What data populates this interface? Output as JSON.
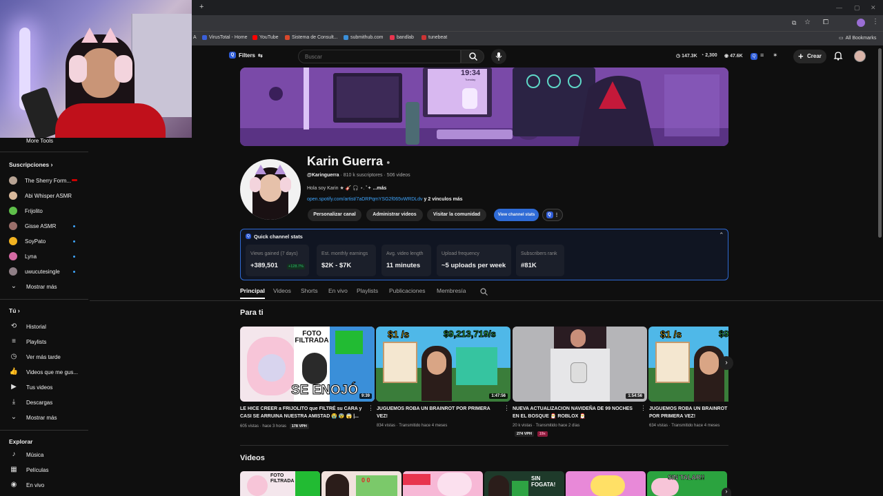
{
  "browser": {
    "new_tab": "+",
    "bookmarks": [
      {
        "label": "A",
        "color": "#888888"
      },
      {
        "label": "VirusTotal - Home",
        "color": "#3a5fd9"
      },
      {
        "label": "YouTube",
        "color": "#ff0000"
      },
      {
        "label": "Sistema de Consult...",
        "color": "#d9482b"
      },
      {
        "label": "submithub.com",
        "color": "#3a8fd9"
      },
      {
        "label": "bandlab",
        "color": "#e8344e"
      },
      {
        "label": "tunebeat",
        "color": "#cc3333"
      }
    ],
    "all_bookmarks": "All Bookmarks"
  },
  "topbar": {
    "filters": "Filters",
    "search_placeholder": "Buscar",
    "stats": [
      "147.3K",
      "2,300",
      "47.6K"
    ],
    "create": "Crear"
  },
  "sidebar": {
    "more_tools": "More Tools",
    "subs_title": "Suscripciones",
    "subscriptions": [
      {
        "name": "The Sherry Form...",
        "color": "#b7a393",
        "live": "red"
      },
      {
        "name": "Abi Whisper ASMR",
        "color": "#d8b89a",
        "live": ""
      },
      {
        "name": "Frijolito",
        "color": "#5fbf4a",
        "live": ""
      },
      {
        "name": "Gisse ASMR",
        "color": "#9b6f6a",
        "live": "blue"
      },
      {
        "name": "SoyPato",
        "color": "#f2b321",
        "live": "blue"
      },
      {
        "name": "Lyna",
        "color": "#d56aa4",
        "live": "blue"
      },
      {
        "name": "uwucutesingle",
        "color": "#8f7f86",
        "live": "blue"
      }
    ],
    "show_more": "Mostrar más",
    "you_title": "Tú",
    "you_items": [
      {
        "label": "Historial",
        "icon": "history-icon",
        "glyph": "⟲"
      },
      {
        "label": "Playlists",
        "icon": "playlists-icon",
        "glyph": "≡"
      },
      {
        "label": "Ver más tarde",
        "icon": "watch-later-icon",
        "glyph": "◷"
      },
      {
        "label": "Videos que me gus...",
        "icon": "like-icon",
        "glyph": "👍"
      },
      {
        "label": "Tus videos",
        "icon": "your-videos-icon",
        "glyph": "▶"
      },
      {
        "label": "Descargas",
        "icon": "downloads-icon",
        "glyph": "⤓"
      },
      {
        "label": "Mostrar más",
        "icon": "chevron-down-icon",
        "glyph": "⌄"
      }
    ],
    "explore_title": "Explorar",
    "explore_items": [
      {
        "label": "Música",
        "icon": "music-icon",
        "glyph": "♪"
      },
      {
        "label": "Películas",
        "icon": "movies-icon",
        "glyph": "▦"
      },
      {
        "label": "En vivo",
        "icon": "live-icon",
        "glyph": "◉"
      }
    ]
  },
  "banner": {
    "clock": "19:34",
    "label": "Tuesday"
  },
  "channel": {
    "name": "Karin Guerra",
    "handle": "@Karinguerra",
    "subscribers": "810 k suscriptores",
    "videos": "506 videos",
    "description": "Hola soy Karin ★ 🎸 🎧 ⋆. ˚✦",
    "more": "...más",
    "link": "open.spotify.com/artist/7aDRPqmYSG2f065vWRDLdv",
    "link_more": "y 2 vínculos más",
    "buttons": [
      "Personalizar canal",
      "Administrar videos",
      "Visitar la comunidad"
    ],
    "view_stats": "View channel stats"
  },
  "quick_stats": {
    "title": "Quick channel stats",
    "cards": [
      {
        "label": "Views gained (7 days)",
        "value": "+389,501",
        "delta": "+128.7%"
      },
      {
        "label": "Est. monthly earnings",
        "value": "$2K - $7K",
        "delta": ""
      },
      {
        "label": "Avg. video length",
        "value": "11 minutes",
        "delta": ""
      },
      {
        "label": "Upload frequency",
        "value": "~5 uploads per week",
        "delta": ""
      },
      {
        "label": "Subscribers rank",
        "value": "#81K",
        "delta": ""
      }
    ]
  },
  "tabs": [
    "Principal",
    "Videos",
    "Shorts",
    "En vivo",
    "Playlists",
    "Publicaciones",
    "Membresía"
  ],
  "sections": {
    "for_you": "Para ti",
    "videos": "Videos"
  },
  "videos": [
    {
      "title": "LE HICE CREER a FRIJOLITO que FILTRÉ su CARA y CASI SE ARRUINA NUESTRA AMISTAD 😭 😰 😱 |...",
      "duration": "9:39",
      "views": "605 vistas",
      "when": "hace 3 horas",
      "vph": "178 VPH",
      "extra": "",
      "thumb_text": "SE ENOJÓ",
      "thumb_top": "FOTO FILTRADA"
    },
    {
      "title": "JUGUEMOS ROBA UN BRAINROT POR PRIMERA VEZ!",
      "duration": "1:47:56",
      "views": "834 vistas",
      "when": "Transmitido hace 4 meses",
      "vph": "",
      "extra": "",
      "thumb_text": "$9,213,719/s",
      "thumb_top": "$1 /s"
    },
    {
      "title": "NUEVA ACTUALIZACION NAVIDEÑA DE 99 NOCHES EN EL BOSQUE 🎅 ROBLOX 🎅",
      "duration": "1:54:56",
      "views": "20 k vistas",
      "when": "Transmitido hace 2 días",
      "vph": "274 VPH",
      "extra": "19x",
      "thumb_text": "",
      "thumb_top": ""
    },
    {
      "title": "JUGUEMOS ROBA UN BRAINROT POR PRIMERA VEZ!",
      "duration": "",
      "views": "634 vistas",
      "when": "Transmitido hace 4 meses",
      "vph": "",
      "extra": "",
      "thumb_text": "$9",
      "thumb_top": "$1 /s"
    }
  ],
  "videos_row2": [
    {
      "text": "FOTO FILTRADA"
    },
    {
      "text": "0 0"
    },
    {
      "text": ""
    },
    {
      "text": "SIN FOGATA!"
    },
    {
      "text": ""
    },
    {
      "text": "SIN TALAR!!"
    }
  ]
}
